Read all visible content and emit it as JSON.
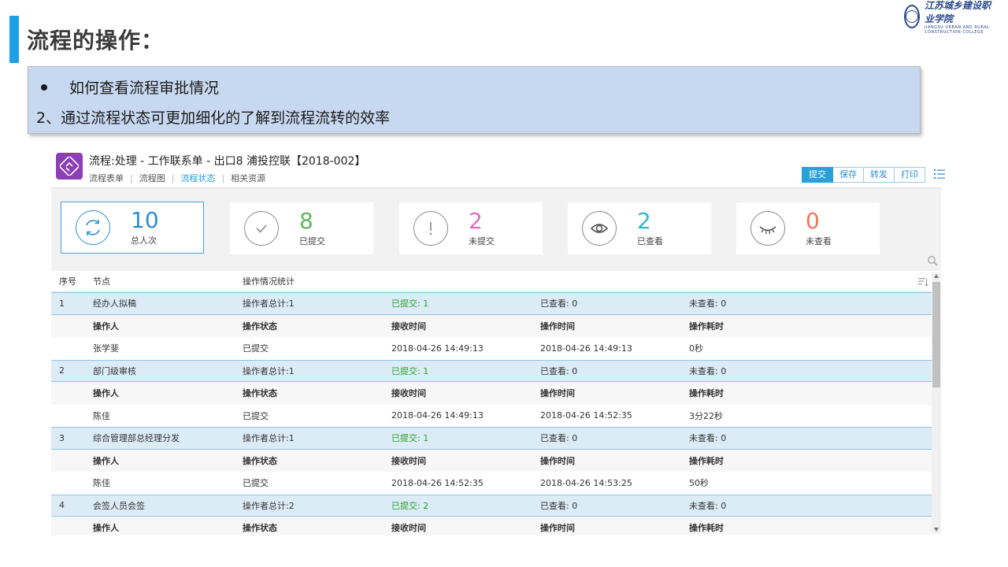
{
  "slide": {
    "title": "流程的操作：",
    "bullet": "如何查看流程审批情况",
    "line2": "2、通过流程状态可更加细化的了解到流程流转的效率",
    "logo_cn": "江苏城乡建设职业学院",
    "logo_en": "JIANGSU URBAN AND RURAL CONSTRUCTION COLLEGE"
  },
  "app": {
    "title": "流程:处理 - 工作联系单 - 出口8 浦投控联【2018-002】",
    "tabs": [
      {
        "label": "流程表单",
        "active": false
      },
      {
        "label": "流程图",
        "active": false
      },
      {
        "label": "流程状态",
        "active": true
      },
      {
        "label": "相关资源",
        "active": false
      }
    ],
    "buttons": {
      "submit": "提交",
      "save": "保存",
      "forward": "转发",
      "print": "打印"
    }
  },
  "stats": [
    {
      "value": "10",
      "label": "总人次",
      "color": "#2a8fd0",
      "icon": "refresh-cycle-icon"
    },
    {
      "value": "8",
      "label": "已提交",
      "color": "#5cb85c",
      "icon": "check-circle-icon"
    },
    {
      "value": "2",
      "label": "未提交",
      "color": "#e06fc2",
      "icon": "exclamation-circle-icon"
    },
    {
      "value": "2",
      "label": "已查看",
      "color": "#35b6c8",
      "icon": "eye-open-icon"
    },
    {
      "value": "0",
      "label": "未查看",
      "color": "#e8795a",
      "icon": "eye-closed-icon"
    }
  ],
  "table": {
    "headers": [
      "序号",
      "节点",
      "操作情况统计"
    ],
    "sub_headers": [
      "操作人",
      "操作状态",
      "接收时间",
      "操作时间",
      "操作耗时"
    ],
    "groups": [
      {
        "no": "1",
        "node": "经办人拟稿",
        "total": "操作者总计:1",
        "submitted": "已提交: 1",
        "viewed": "已查看: 0",
        "unviewed": "未查看: 0",
        "details": [
          {
            "operator": "张学斐",
            "status": "已提交",
            "received": "2018-04-26 14:49:13",
            "operated": "2018-04-26 14:49:13",
            "duration": "0秒"
          }
        ]
      },
      {
        "no": "2",
        "node": "部门级审核",
        "total": "操作者总计:1",
        "submitted": "已提交: 1",
        "viewed": "已查看: 0",
        "unviewed": "未查看: 0",
        "details": [
          {
            "operator": "陈佳",
            "status": "已提交",
            "received": "2018-04-26 14:49:13",
            "operated": "2018-04-26 14:52:35",
            "duration": "3分22秒"
          }
        ]
      },
      {
        "no": "3",
        "node": "综合管理部总经理分发",
        "total": "操作者总计:1",
        "submitted": "已提交: 1",
        "viewed": "已查看: 0",
        "unviewed": "未查看: 0",
        "details": [
          {
            "operator": "陈佳",
            "status": "已提交",
            "received": "2018-04-26 14:52:35",
            "operated": "2018-04-26 14:53:25",
            "duration": "50秒"
          }
        ]
      },
      {
        "no": "4",
        "node": "会签人员会签",
        "total": "操作者总计:2",
        "submitted": "已提交: 2",
        "viewed": "已查看: 0",
        "unviewed": "未查看: 0",
        "details": []
      }
    ]
  }
}
